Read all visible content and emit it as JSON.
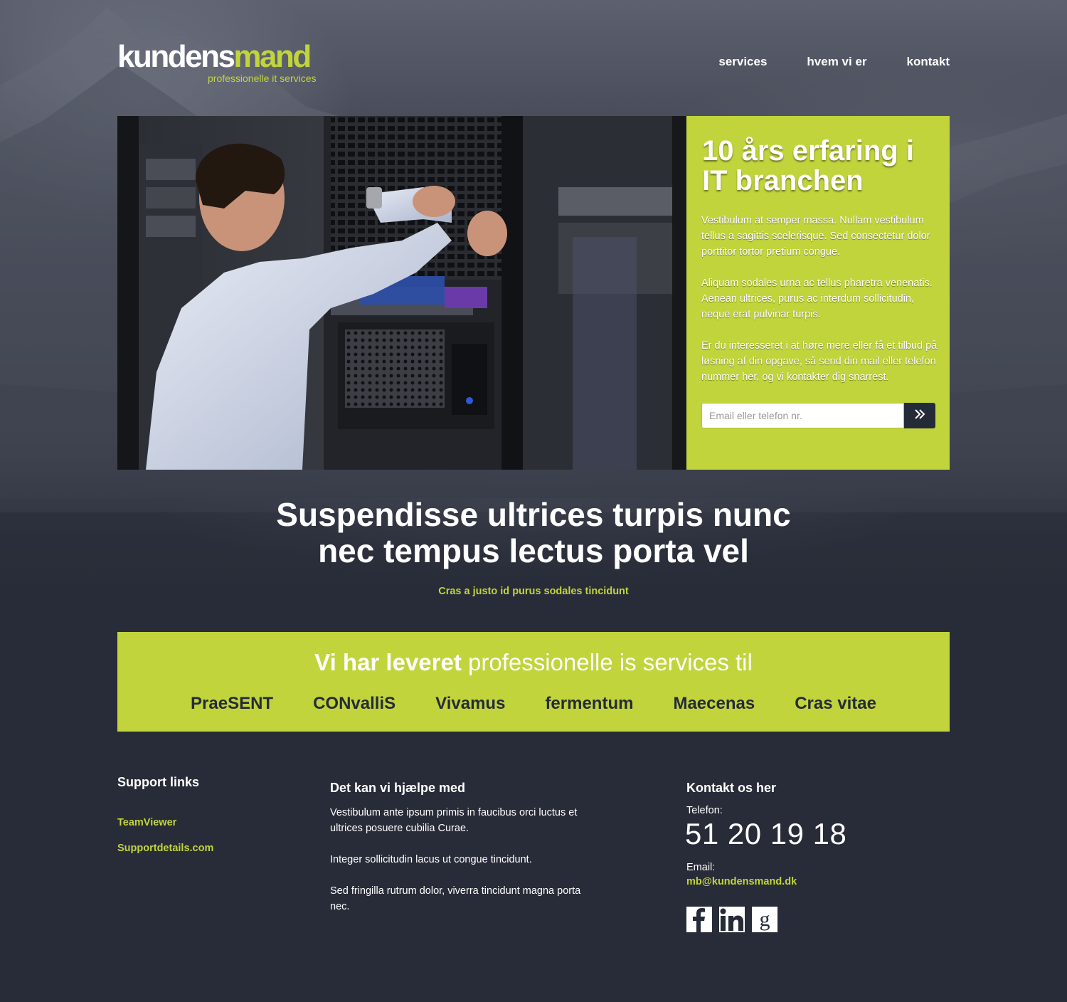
{
  "header": {
    "logo_part1": "kundens",
    "logo_part2": "mand",
    "logo_tagline": "professionelle it services",
    "nav": [
      "services",
      "hvem vi er",
      "kontakt"
    ]
  },
  "hero": {
    "heading": "10 års erfaring i IT branchen",
    "paragraphs": [
      "Vestibulum at semper massa. Nullam vestibulum tellus a sagittis scelerisque. Sed consectetur dolor porttitor tortor pretium congue.",
      "Aliquam sodales urna ac tellus pharetra venenatis. Aenean ultrices, purus ac interdum sollicitudin, neque erat pulvinar turpis.",
      "Er du interesseret i at høre mere eller få et tilbud på løsning af din opgave, så send din mail eller telefon nummer her, og vi kontakter dig snarrest."
    ],
    "input_placeholder": "Email eller telefon nr.",
    "submit_icon": "double-chevron-right-icon"
  },
  "tagline": {
    "line1": "Suspendisse ultrices turpis nunc",
    "line2": "nec tempus lectus porta vel",
    "sub": "Cras a justo id purus sodales tincidunt"
  },
  "clients": {
    "title_bold": "Vi har leveret",
    "title_light": "professionelle is services til",
    "names": [
      "PraeSENT",
      "CONvalliS",
      "Vivamus",
      "fermentum",
      "Maecenas",
      "Cras vitae"
    ]
  },
  "footer": {
    "support": {
      "heading": "Support links",
      "links": [
        "TeamViewer",
        "Supportdetails.com"
      ]
    },
    "help": {
      "heading": "Det kan vi hjælpe med",
      "paragraphs": [
        "Vestibulum ante ipsum primis in faucibus orci luctus et ultrices posuere cubilia Curae.",
        "Integer sollicitudin lacus ut congue tincidunt.",
        "Sed fringilla rutrum dolor, viverra tincidunt magna porta nec."
      ]
    },
    "contact": {
      "heading": "Kontakt os her",
      "phone_label": "Telefon:",
      "phone": "51 20 19 18",
      "email_label": "Email:",
      "email": "mb@kundensmand.dk",
      "social": [
        "facebook-icon",
        "linkedin-icon",
        "google-icon"
      ]
    }
  },
  "colors": {
    "accent": "#c1d43c",
    "background": "#282c38",
    "dark_text": "#262b38"
  }
}
